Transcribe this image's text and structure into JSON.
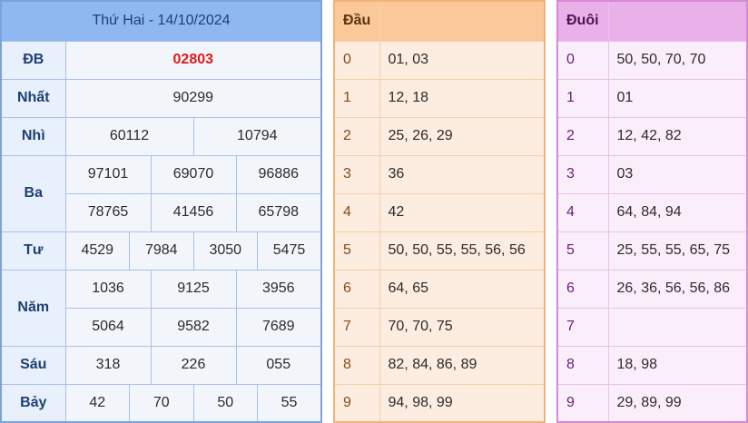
{
  "title": "Thứ Hai - 14/10/2024",
  "prizes": {
    "db": {
      "label": "ĐB",
      "values": [
        "02803"
      ]
    },
    "nhat": {
      "label": "Nhất",
      "values": [
        "90299"
      ]
    },
    "nhi": {
      "label": "Nhì",
      "values": [
        "60112",
        "10794"
      ]
    },
    "ba": {
      "label": "Ba",
      "values": [
        "97101",
        "69070",
        "96886",
        "78765",
        "41456",
        "65798"
      ]
    },
    "tu": {
      "label": "Tư",
      "values": [
        "4529",
        "7984",
        "3050",
        "5475"
      ]
    },
    "nam": {
      "label": "Năm",
      "values": [
        "1036",
        "9125",
        "3956",
        "5064",
        "9582",
        "7689"
      ]
    },
    "sau": {
      "label": "Sáu",
      "values": [
        "318",
        "226",
        "055"
      ]
    },
    "bay": {
      "label": "Bảy",
      "values": [
        "42",
        "70",
        "50",
        "55"
      ]
    }
  },
  "dau": {
    "header": "Đầu",
    "rows": [
      {
        "k": "0",
        "v": "01, 03"
      },
      {
        "k": "1",
        "v": "12, 18"
      },
      {
        "k": "2",
        "v": "25, 26, 29"
      },
      {
        "k": "3",
        "v": "36"
      },
      {
        "k": "4",
        "v": "42"
      },
      {
        "k": "5",
        "v": "50, 50, 55, 55, 56, 56"
      },
      {
        "k": "6",
        "v": "64, 65"
      },
      {
        "k": "7",
        "v": "70, 70, 75"
      },
      {
        "k": "8",
        "v": "82, 84, 86, 89"
      },
      {
        "k": "9",
        "v": "94, 98, 99"
      }
    ]
  },
  "duoi": {
    "header": "Đuôi",
    "rows": [
      {
        "k": "0",
        "v": "50, 50, 70, 70"
      },
      {
        "k": "1",
        "v": "01"
      },
      {
        "k": "2",
        "v": "12, 42, 82"
      },
      {
        "k": "3",
        "v": "03"
      },
      {
        "k": "4",
        "v": "64, 84, 94"
      },
      {
        "k": "5",
        "v": "25, 55, 55, 65, 75"
      },
      {
        "k": "6",
        "v": "26, 36, 56, 56, 86"
      },
      {
        "k": "7",
        "v": ""
      },
      {
        "k": "8",
        "v": "18, 98"
      },
      {
        "k": "9",
        "v": "29, 89, 99"
      }
    ]
  },
  "colors": {
    "special_value": "#e01919",
    "result_header": "#90b8f0",
    "dau_header": "#fbc89a",
    "duoi_header": "#eab0ea"
  }
}
